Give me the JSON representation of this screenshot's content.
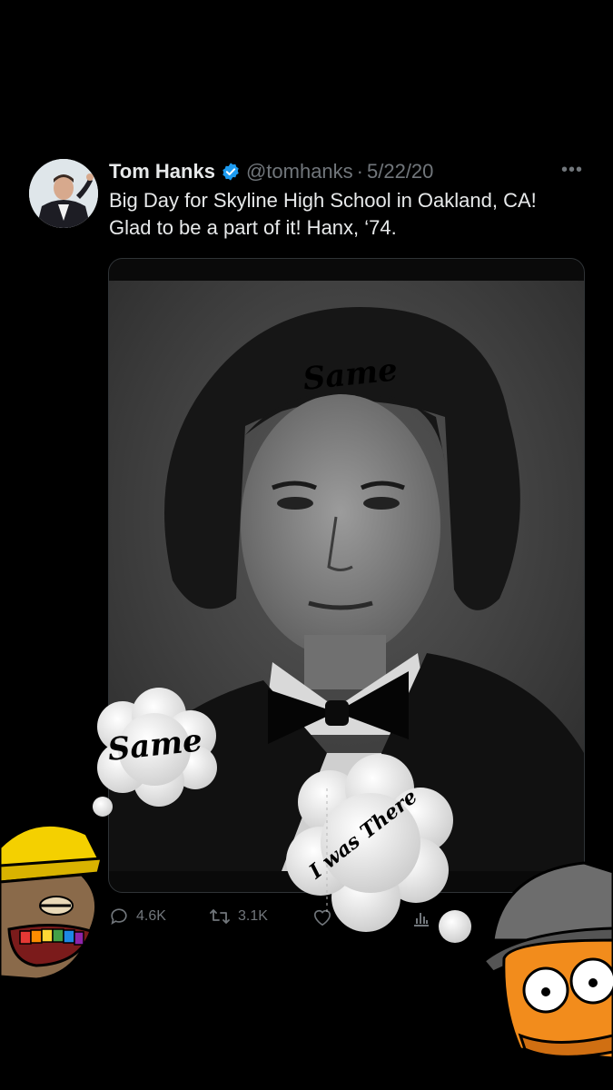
{
  "tweet": {
    "author_name": "Tom Hanks",
    "handle": "@tomhanks",
    "separator": "·",
    "date": "5/22/20",
    "more_label": "•••",
    "text": "Big Day for Skyline High School in Oakland, CA!  Glad to be a part of it!  Hanx, ‘74."
  },
  "stats": {
    "replies": "4.6K",
    "retweets": "3.1K"
  },
  "overlay": {
    "photo_caption": "Same",
    "cloud_left_text": "Same",
    "cloud_right_text": "I was There"
  },
  "colors": {
    "background": "#000000",
    "verified": "#1d9bf0",
    "muted": "#71767b",
    "text": "#e7e9ea"
  },
  "icons": [
    "verified-badge-icon",
    "more-icon",
    "reply-icon",
    "retweet-icon",
    "like-icon",
    "views-icon"
  ]
}
